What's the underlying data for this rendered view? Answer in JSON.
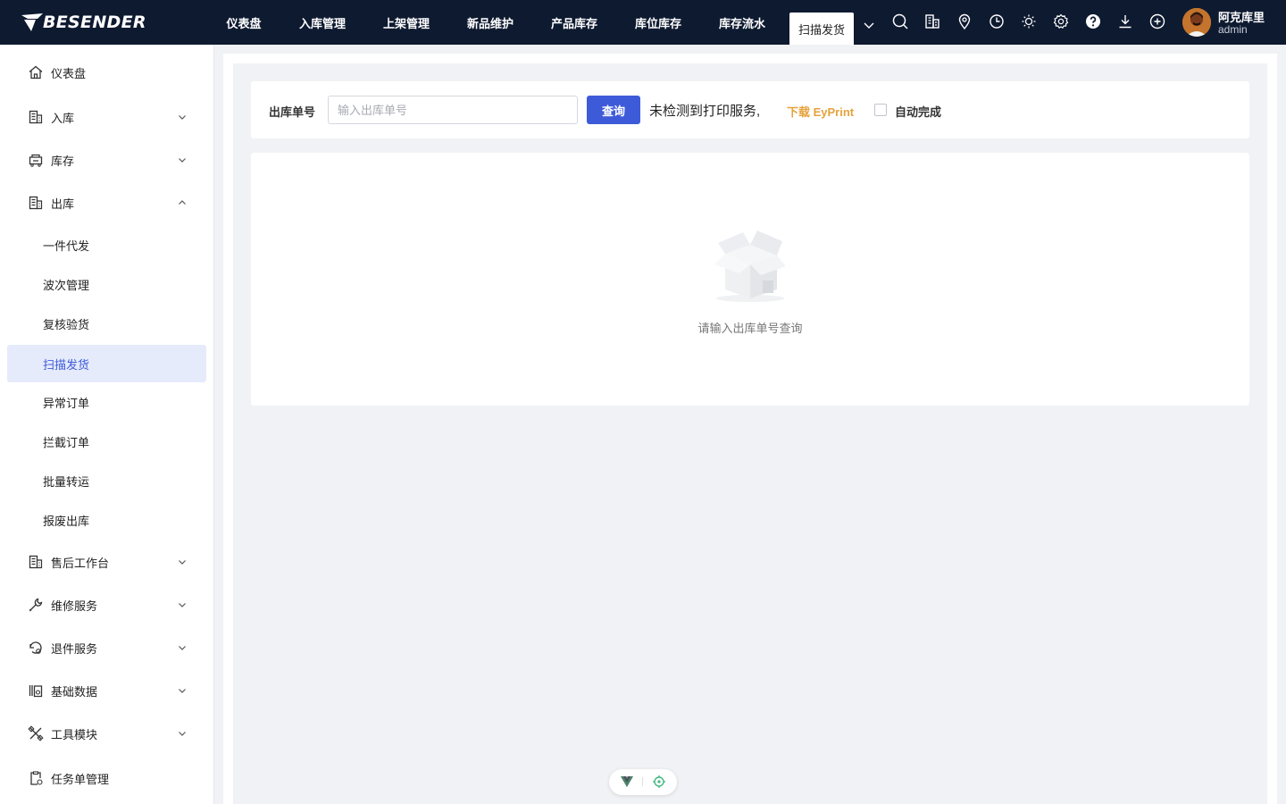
{
  "header": {
    "logo_text": "BESENDER",
    "tabs": [
      {
        "label": "仪表盘"
      },
      {
        "label": "入库管理"
      },
      {
        "label": "上架管理"
      },
      {
        "label": "新品维护"
      },
      {
        "label": "产品库存"
      },
      {
        "label": "库位库存"
      },
      {
        "label": "库存流水"
      },
      {
        "label": "扫描发货",
        "active": true
      }
    ],
    "tool_icons": [
      "search-icon",
      "building-icon",
      "location-pin-icon",
      "clock-icon",
      "sun-icon",
      "gear-icon",
      "help-icon",
      "download-icon",
      "plus-circle-icon"
    ],
    "user": {
      "name": "阿克库里",
      "role": "admin"
    }
  },
  "sidebar": {
    "items": [
      {
        "label": "仪表盘",
        "icon": "home-icon"
      },
      {
        "label": "入库",
        "icon": "inbound-icon"
      },
      {
        "label": "库存",
        "icon": "inventory-icon"
      },
      {
        "label": "出库",
        "icon": "outbound-icon",
        "expanded": true
      },
      {
        "label": "售后工作台",
        "icon": "aftersales-icon"
      },
      {
        "label": "维修服务",
        "icon": "wrench-icon"
      },
      {
        "label": "退件服务",
        "icon": "return-icon"
      },
      {
        "label": "基础数据",
        "icon": "database-icon"
      },
      {
        "label": "工具模块",
        "icon": "tools-icon"
      },
      {
        "label": "任务单管理",
        "icon": "task-icon"
      }
    ],
    "outbound_children": [
      {
        "label": "一件代发"
      },
      {
        "label": "波次管理"
      },
      {
        "label": "复核验货"
      },
      {
        "label": "扫描发货",
        "active": true
      },
      {
        "label": "异常订单"
      },
      {
        "label": "拦截订单"
      },
      {
        "label": "批量转运"
      },
      {
        "label": "报废出库"
      }
    ]
  },
  "search": {
    "label": "出库单号",
    "placeholder": "输入出库单号",
    "value": "",
    "query_button": "查询",
    "status_text": "未检测到打印服务,",
    "download_link": "下载 EyPrint",
    "auto_complete_label": "自动完成",
    "auto_complete_checked": false
  },
  "result": {
    "empty_text": "请输入出库单号查询"
  },
  "colors": {
    "topbar_bg": "#0e1a30",
    "primary": "#3d5bd9",
    "active_bg": "#e6ebfb",
    "link_warning": "#e6a23c"
  }
}
